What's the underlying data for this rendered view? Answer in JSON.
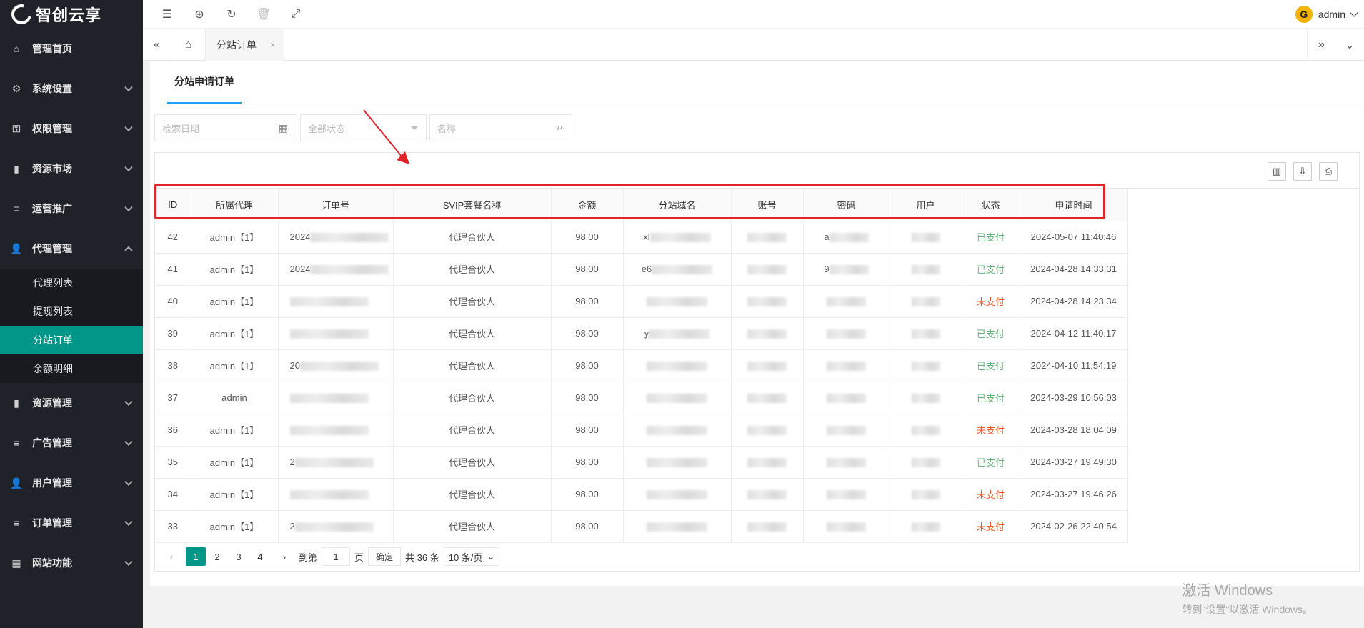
{
  "brand": "智创云享",
  "header": {
    "username": "admin",
    "avatar_letter": "G"
  },
  "sidebar": {
    "items": [
      {
        "label": "管理首页",
        "icon": "home-icon"
      },
      {
        "label": "系统设置",
        "icon": "gear-icon"
      },
      {
        "label": "权限管理",
        "icon": "user-key-icon"
      },
      {
        "label": "资源市场",
        "icon": "book-icon"
      },
      {
        "label": "运营推广",
        "icon": "list-icon"
      },
      {
        "label": "代理管理",
        "icon": "users-icon"
      },
      {
        "label": "资源管理",
        "icon": "book-icon"
      },
      {
        "label": "广告管理",
        "icon": "list-icon"
      },
      {
        "label": "用户管理",
        "icon": "user-icon"
      },
      {
        "label": "订单管理",
        "icon": "list-icon"
      },
      {
        "label": "网站功能",
        "icon": "grid-icon"
      }
    ],
    "sub_items": [
      "代理列表",
      "提现列表",
      "分站订单",
      "余额明细"
    ]
  },
  "tabs": {
    "current": "分站订单",
    "close": "×"
  },
  "panel": {
    "tab": "分站申请订单"
  },
  "filters": {
    "date_placeholder": "检索日期",
    "status_placeholder": "全部状态",
    "name_placeholder": "名称"
  },
  "table": {
    "columns": [
      "ID",
      "所属代理",
      "订单号",
      "SVIP套餐名称",
      "金额",
      "分站域名",
      "账号",
      "密码",
      "用户",
      "状态",
      "申请时间"
    ],
    "rows": [
      {
        "id": "42",
        "agent": "admin【1】",
        "order": "2024",
        "plan": "代理合伙人",
        "amount": "98.00",
        "domain": "xl",
        "account": "",
        "password": "a",
        "user": "",
        "status": "已支付",
        "paid": true,
        "time": "2024-05-07 11:40:46"
      },
      {
        "id": "41",
        "agent": "admin【1】",
        "order": "2024",
        "plan": "代理合伙人",
        "amount": "98.00",
        "domain": "e6",
        "account": "",
        "password": "9",
        "user": "",
        "status": "已支付",
        "paid": true,
        "time": "2024-04-28 14:33:31"
      },
      {
        "id": "40",
        "agent": "admin【1】",
        "order": "",
        "plan": "代理合伙人",
        "amount": "98.00",
        "domain": "",
        "account": "",
        "password": "",
        "user": "",
        "status": "未支付",
        "paid": false,
        "time": "2024-04-28 14:23:34"
      },
      {
        "id": "39",
        "agent": "admin【1】",
        "order": "",
        "plan": "代理合伙人",
        "amount": "98.00",
        "domain": "y",
        "account": "",
        "password": "",
        "user": "",
        "status": "已支付",
        "paid": true,
        "time": "2024-04-12 11:40:17"
      },
      {
        "id": "38",
        "agent": "admin【1】",
        "order": "20",
        "plan": "代理合伙人",
        "amount": "98.00",
        "domain": "",
        "account": "",
        "password": "",
        "user": "",
        "status": "已支付",
        "paid": true,
        "time": "2024-04-10 11:54:19"
      },
      {
        "id": "37",
        "agent": "admin",
        "order": "",
        "plan": "代理合伙人",
        "amount": "98.00",
        "domain": "",
        "account": "",
        "password": "",
        "user": "",
        "status": "已支付",
        "paid": true,
        "time": "2024-03-29 10:56:03"
      },
      {
        "id": "36",
        "agent": "admin【1】",
        "order": "",
        "plan": "代理合伙人",
        "amount": "98.00",
        "domain": "",
        "account": "",
        "password": "",
        "user": "",
        "status": "未支付",
        "paid": false,
        "time": "2024-03-28 18:04:09"
      },
      {
        "id": "35",
        "agent": "admin【1】",
        "order": "2",
        "plan": "代理合伙人",
        "amount": "98.00",
        "domain": "",
        "account": "",
        "password": "",
        "user": "",
        "status": "已支付",
        "paid": true,
        "time": "2024-03-27 19:49:30"
      },
      {
        "id": "34",
        "agent": "admin【1】",
        "order": "",
        "plan": "代理合伙人",
        "amount": "98.00",
        "domain": "",
        "account": "",
        "password": "",
        "user": "",
        "status": "未支付",
        "paid": false,
        "time": "2024-03-27 19:46:26"
      },
      {
        "id": "33",
        "agent": "admin【1】",
        "order": "2",
        "plan": "代理合伙人",
        "amount": "98.00",
        "domain": "",
        "account": "",
        "password": "",
        "user": "",
        "status": "未支付",
        "paid": false,
        "time": "2024-02-26 22:40:54"
      }
    ]
  },
  "pagination": {
    "pages": [
      "1",
      "2",
      "3",
      "4"
    ],
    "goto_label": "到第",
    "goto_value": "1",
    "page_unit": "页",
    "confirm": "确定",
    "total": "共 36 条",
    "page_size": "10 条/页"
  },
  "watermark": {
    "line1": "激活 Windows",
    "line2": "转到\"设置\"以激活 Windows。"
  },
  "colors": {
    "sidebar_bg": "#20222a",
    "accent": "#009688",
    "paid": "#5fb878",
    "unpaid": "#ff5722",
    "highlight": "#e0242a"
  }
}
